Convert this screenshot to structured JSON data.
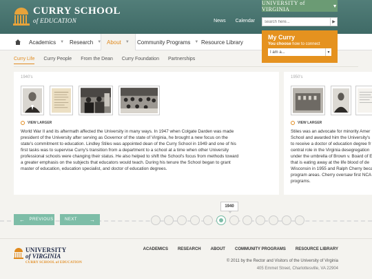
{
  "header": {
    "logo_line1": "CURRY SCHOOL",
    "logo_line2": "of EDUCATION",
    "uva_label": "UNIVERSITY of VIRGINIA",
    "links": [
      "News",
      "Calendar"
    ],
    "search_placeholder": "search here..."
  },
  "nav": {
    "items": [
      "Academics",
      "Research",
      "About",
      "Community Programs",
      "Resource Library"
    ],
    "active": "About"
  },
  "mycurry": {
    "title": "My Curry",
    "subtitle_bold": "You choose",
    "subtitle_rest": " how to connect",
    "select_value": "I am a..."
  },
  "subnav": {
    "items": [
      "Curry Life",
      "Curry People",
      "From the Dean",
      "Curry Foundation",
      "Partnerships"
    ],
    "active": "Curry Life"
  },
  "panels": {
    "main": {
      "year": "1940's",
      "view_larger": "VIEW LARGER",
      "text": "World War II and its aftermath affected the University in many ways.  In 1947 when Colgate Darden was made president of the University after serving as Governor of the state of Virginia, he brought a new focus on the state's commitment to education. Lindley Stiles was appointed dean of the Curry School in 1949 and one of his first tasks was to supervise Curry's transition from a department to a school at a time when other University professional schools were changing their status. He also helped to shift the School's focus from methods toward a greater emphasis on the subjects that educators would teach. During his tenure the School began to grant master of education, education specialist, and doctor of education degrees."
    },
    "right": {
      "year": "1950's",
      "view_larger": "VIEW LARGER",
      "lines": [
        "Stiles was an advocate for minority Amer",
        "School and awarded him the University's",
        "to receive a doctor of education degree fr",
        "central role in the Virginia desegregation",
        "under the umbrella of Brown v. Board of E",
        "that is eating away at the life blood of de",
        "Wisconsin in 1955 and Ralph Cherry beca",
        "program areas. Cherry oversaw first NCA",
        "programs."
      ]
    }
  },
  "timeline": {
    "prev_label": "PREVIOUS",
    "next_label": "NEXT",
    "current_year": "1940",
    "dot_count": 12,
    "active_index": 5
  },
  "footer": {
    "logo_a": "UNIVERSITY",
    "logo_b": "of VIRGINIA",
    "logo_c": "CURRY SCHOOL of EDUCATION",
    "links": [
      "ACADEMICS",
      "RESEARCH",
      "ABOUT",
      "COMMUNITY PROGRAMS",
      "RESOURCE LIBRARY"
    ],
    "copyright": "© 2011 by the Rector and Visitors of the University of Virginia",
    "address": "405 Emmet Street, Charlottesville, VA 22904"
  },
  "colors": {
    "header_teal": "#467270",
    "accent_orange": "#e5921f",
    "mint": "#7dbda7",
    "navy": "#232d4b"
  }
}
